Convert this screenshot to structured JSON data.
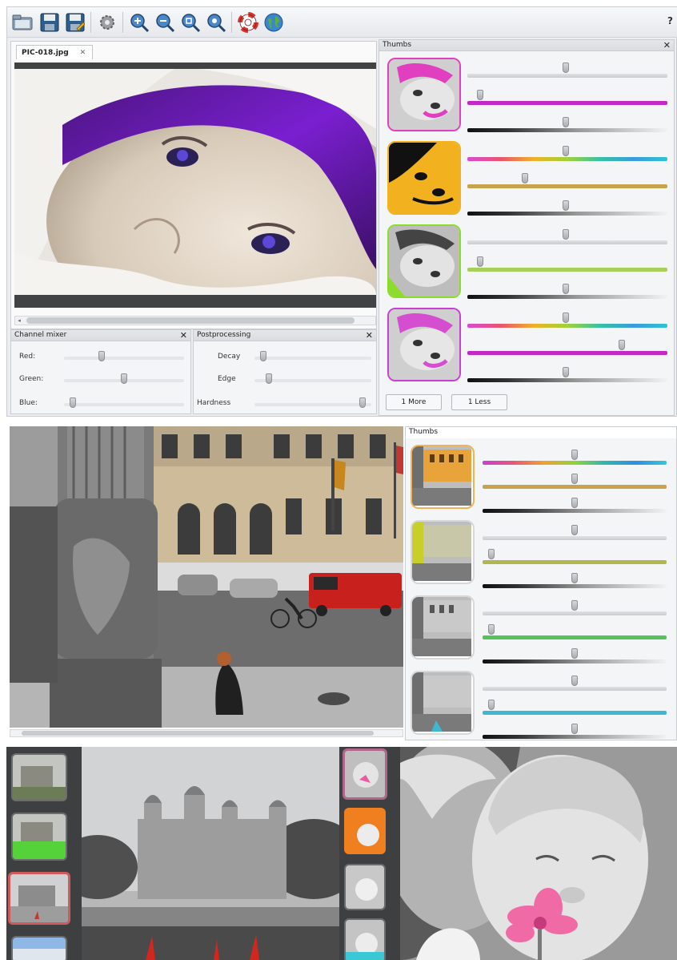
{
  "editor": {
    "tab_title": "PIC-018.jpg",
    "tab_close": "✕",
    "help": "?",
    "toolbar_icons": [
      "open-folder-icon",
      "save-icon",
      "save-as-icon",
      "settings-gear-icon",
      "zoom-in-icon",
      "zoom-out-icon",
      "zoom-fit-icon",
      "zoom-actual-icon",
      "help-lifebuoy-icon",
      "web-globe-icon"
    ]
  },
  "thumbs_panel": {
    "title": "Thumbs",
    "close": "✕",
    "more_label": "1 More",
    "less_label": "1 Less",
    "rows": [
      {
        "accent": "#e23fc0",
        "sliders": [
          {
            "value": 0.49,
            "track": "gray"
          },
          {
            "value": 0.05,
            "track": "#c228c5"
          },
          {
            "value": 0.49,
            "track": "dark"
          }
        ]
      },
      {
        "accent": "#f2b21f",
        "sliders": [
          {
            "value": 0.49,
            "track": "rainbow"
          },
          {
            "value": 0.28,
            "track": "#c9a24e"
          },
          {
            "value": 0.49,
            "track": "dark"
          }
        ]
      },
      {
        "accent": "#8ddc2b",
        "sliders": [
          {
            "value": 0.49,
            "track": "gray"
          },
          {
            "value": 0.05,
            "track": "#a8cf5a"
          },
          {
            "value": 0.49,
            "track": "dark"
          }
        ]
      },
      {
        "accent": "#c93fd3",
        "sliders": [
          {
            "value": 0.49,
            "track": "rainbow"
          },
          {
            "value": 0.78,
            "track": "#c228c5"
          },
          {
            "value": 0.49,
            "track": "dark"
          }
        ]
      }
    ]
  },
  "channel_mixer": {
    "title": "Channel mixer",
    "close": "✕",
    "sliders": [
      {
        "label": "Red:",
        "value": 0.3
      },
      {
        "label": "Green:",
        "value": 0.5
      },
      {
        "label": "Blue:",
        "value": 0.05
      }
    ]
  },
  "postprocessing": {
    "title": "Postprocessing",
    "close": "✕",
    "sliders": [
      {
        "label": "Decay",
        "value": 0.05
      },
      {
        "label": "Edge",
        "value": 0.1
      },
      {
        "label": "Hardness",
        "value": 0.95
      }
    ]
  },
  "thumbs_panel_2": {
    "title": "Thumbs",
    "rows": [
      {
        "accent": "#f0b35a",
        "sliders": [
          {
            "value": 0.5,
            "track": "rainbow2"
          },
          {
            "value": 0.5,
            "track": "#c9a24e"
          },
          {
            "value": 0.5,
            "track": "dark"
          }
        ]
      },
      {
        "accent": "#d8d8d8",
        "sliders": [
          {
            "value": 0.5,
            "track": "gray"
          },
          {
            "value": 0.03,
            "track": "#b2b64f"
          },
          {
            "value": 0.5,
            "track": "dark"
          }
        ]
      },
      {
        "accent": "#d8d8d8",
        "sliders": [
          {
            "value": 0.5,
            "track": "gray"
          },
          {
            "value": 0.03,
            "track": "#55c35a"
          },
          {
            "value": 0.5,
            "track": "dark"
          }
        ]
      },
      {
        "accent": "#d8d8d8",
        "sliders": [
          {
            "value": 0.5,
            "track": "gray"
          },
          {
            "value": 0.03,
            "track": "#3fb7d3"
          },
          {
            "value": 0.5,
            "track": "dark"
          }
        ]
      }
    ]
  }
}
